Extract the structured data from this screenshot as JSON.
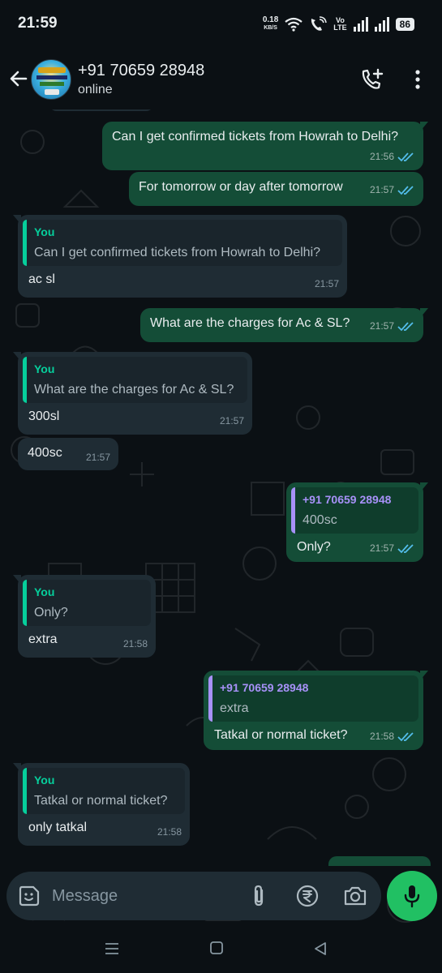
{
  "status_bar": {
    "time": "21:59",
    "net_speed": "0.18",
    "net_unit": "KB/S",
    "volte_top": "Vo",
    "volte_bottom": "LTE",
    "battery": "86"
  },
  "header": {
    "contact_name": "+91 70659 28948",
    "status": "online",
    "avatar_icon": "railway-logo-avatar",
    "call_icon": "add-call-icon",
    "menu_icon": "more-vert-icon"
  },
  "messages": [
    {
      "dir": "out",
      "text": "Can I get confirmed tickets from Howrah to Delhi?",
      "time": "21:56",
      "read": true
    },
    {
      "dir": "out",
      "text": "For tomorrow or day after tomorrow",
      "time": "21:57",
      "read": true
    },
    {
      "dir": "in",
      "quote_author": "You",
      "quote_text": "Can I get confirmed tickets from Howrah to Delhi?",
      "text": "ac sl",
      "time": "21:57"
    },
    {
      "dir": "out",
      "text": "What are the charges for Ac & SL?",
      "time": "21:57",
      "read": true
    },
    {
      "dir": "in",
      "quote_author": "You",
      "quote_text": "What are the charges for Ac & SL?",
      "text": "300sl",
      "time": "21:57"
    },
    {
      "dir": "in",
      "text": "400sc",
      "time": "21:57"
    },
    {
      "dir": "out",
      "quote_author": "+91 70659 28948",
      "quote_text": "400sc",
      "text": "Only?",
      "time": "21:57",
      "read": true
    },
    {
      "dir": "in",
      "quote_author": "You",
      "quote_text": "Only?",
      "text": "extra",
      "time": "21:58"
    },
    {
      "dir": "out",
      "quote_author": "+91 70659 28948",
      "quote_text": "extra",
      "text": "Tatkal or normal ticket?",
      "time": "21:58",
      "read": true
    },
    {
      "dir": "in",
      "quote_author": "You",
      "quote_text": "Tatkal or normal ticket?",
      "text": "only tatkal",
      "time": "21:58"
    }
  ],
  "composer": {
    "placeholder": "Message",
    "sticker_icon": "sticker-icon",
    "attach_icon": "paperclip-icon",
    "payment_icon": "rupee-icon",
    "camera_icon": "camera-icon",
    "mic_icon": "mic-icon"
  },
  "colors": {
    "background": "#0b1014",
    "outgoing_bubble": "#144d37",
    "incoming_bubble": "#1f2c34",
    "read_ticks": "#53bdeb",
    "mic_button": "#21c063"
  }
}
